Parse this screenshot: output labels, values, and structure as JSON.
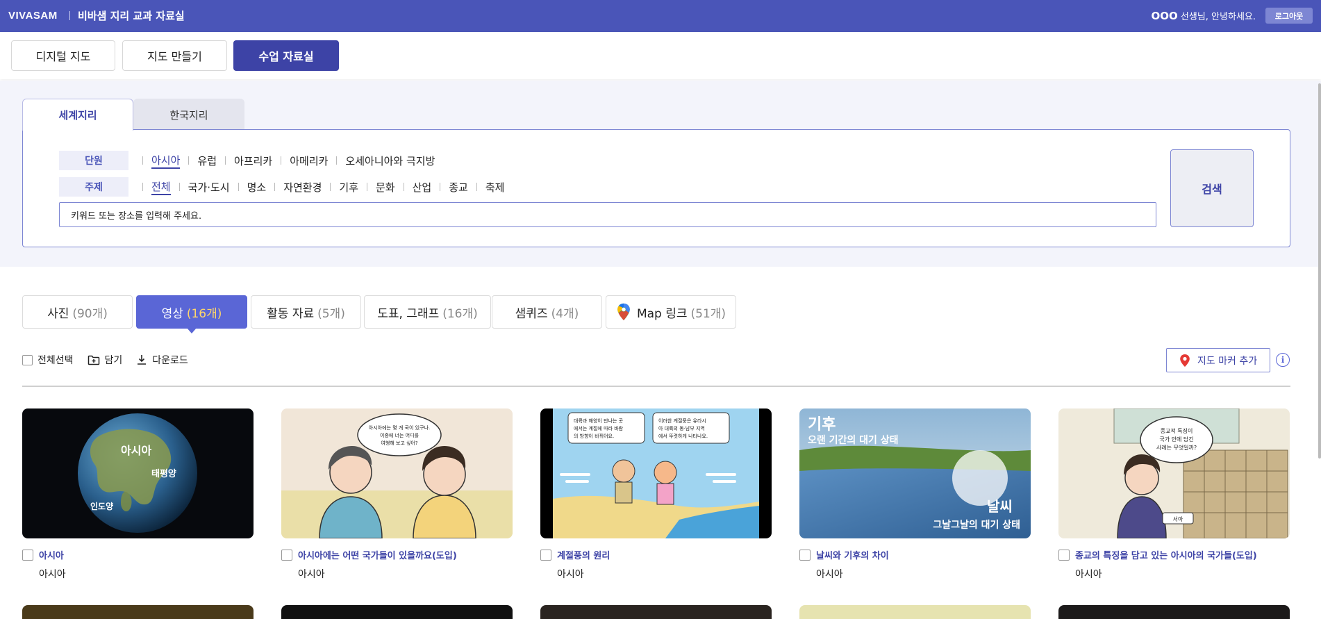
{
  "header": {
    "logo": "VIVASAM",
    "title": "비바샘 지리 교과 자료실",
    "greeting_name": "OOO",
    "greeting_text": " 선생님, 안녕하세요.",
    "logout": "로그아웃"
  },
  "main_nav": {
    "items": [
      {
        "label": "디지털 지도"
      },
      {
        "label": "지도 만들기"
      },
      {
        "label": "수업 자료실",
        "active": true
      }
    ]
  },
  "search": {
    "region_tabs": [
      {
        "label": "세계지리",
        "active": true
      },
      {
        "label": "한국지리"
      }
    ],
    "unit_label": "단원",
    "units": [
      "아시아",
      "유럽",
      "아프리카",
      "아메리카",
      "오세아니아와 극지방"
    ],
    "unit_selected": "아시아",
    "topic_label": "주제",
    "topics": [
      "전체",
      "국가·도시",
      "명소",
      "자연환경",
      "기후",
      "문화",
      "산업",
      "종교",
      "축제"
    ],
    "topic_selected": "전체",
    "keyword_placeholder": "키워드 또는 장소를 입력해 주세요.",
    "search_button": "검색"
  },
  "content_tabs": [
    {
      "label": "사진",
      "count": "(90개)"
    },
    {
      "label": "영상",
      "count": "(16개)",
      "active": true
    },
    {
      "label": "활동 자료",
      "count": "(5개)"
    },
    {
      "label": "도표, 그래프",
      "count": "(16개)"
    },
    {
      "label": "샘퀴즈",
      "count": "(4개)"
    },
    {
      "label": "Map 링크",
      "count": "(51개)",
      "icon": "google-maps-pin-icon"
    }
  ],
  "toolbar": {
    "select_all": "전체선택",
    "save": "담기",
    "download": "다운로드",
    "add_marker": "지도 마커 추가",
    "info": "i"
  },
  "cards": [
    {
      "title": "아시아",
      "subtitle": "아시아",
      "thumb_text": [
        "아시아",
        "태평양",
        "인도양"
      ]
    },
    {
      "title": "아시아에는 어떤 국가들이 있을까요(도입)",
      "subtitle": "아시아",
      "thumb_text": [
        "아시아에는 몇 개 국이 있구나.",
        "이중에 너는 어디를",
        "여행해 보고 싶어?"
      ]
    },
    {
      "title": "계절풍의 원리",
      "subtitle": "아시아",
      "thumb_text": [
        "대륙과 해양이 만나는 곳",
        "에서는 계절에 따라 바람",
        "의 방향이 바뀌어요.",
        "이러한 계절풍은 유라시",
        "아 대륙의 동·남부 지역",
        "에서 뚜렷하게 나타나요."
      ]
    },
    {
      "title": "날씨와 기후의 차이",
      "subtitle": "아시아",
      "thumb_text": [
        "기후",
        "오랜 기간의 대기 상태",
        "날씨",
        "그날그날의 대기 상태"
      ]
    },
    {
      "title": "종교의 특징을 담고 있는 아시아의 국가들(도입)",
      "subtitle": "아시아",
      "thumb_text": [
        "종교적 특징이",
        "국가 안에 담긴",
        "사례는 무엇일까?",
        "서아"
      ]
    }
  ],
  "colors": {
    "header": "#4a55b8",
    "primary": "#3d43a6",
    "tab_active": "#5a66d6",
    "count_active": "#ffd66b"
  }
}
